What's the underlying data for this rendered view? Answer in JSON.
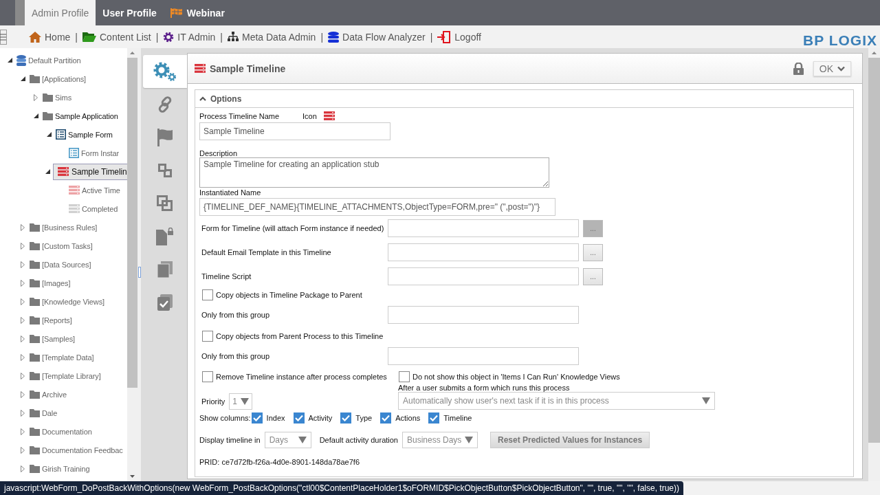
{
  "top_tabs": [
    {
      "label": "Admin Profile",
      "selected": true,
      "kind": "plain"
    },
    {
      "label": "User Profile",
      "selected": false,
      "kind": "plain"
    },
    {
      "label": "Webinar",
      "selected": false,
      "kind": "flagged"
    }
  ],
  "nav_links": [
    {
      "label": "Home",
      "kind": "home"
    },
    {
      "label": "Content List",
      "kind": "folder"
    },
    {
      "label": "IT Admin",
      "kind": "gear"
    },
    {
      "label": "Meta Data Admin",
      "kind": "hierarchy"
    },
    {
      "label": "Data Flow Analyzer",
      "kind": "database"
    },
    {
      "label": "Logoff",
      "kind": "logoff"
    }
  ],
  "nav_separator": "|",
  "logo": "BP LOGIX",
  "tree": [
    {
      "label": "Default Partition",
      "kind": "database",
      "expanded": true,
      "selected": false,
      "active": false,
      "children": [
        {
          "label": "[Applications]",
          "kind": "folder",
          "expanded": true,
          "selected": false,
          "active": false,
          "children": [
            {
              "label": "Sims",
              "kind": "folder",
              "expanded": false,
              "selected": false,
              "active": false
            },
            {
              "label": "Sample Application",
              "kind": "folder",
              "expanded": true,
              "selected": false,
              "active": true,
              "children": [
                {
                  "label": "Sample Form",
                  "kind": "form",
                  "expanded": true,
                  "selected": false,
                  "active": true,
                  "children": [
                    {
                      "label": "Form Instar",
                      "kind": "form-instance",
                      "selected": false,
                      "active": false
                    }
                  ]
                },
                {
                  "label": "Sample Timelin",
                  "kind": "timeline",
                  "expanded": true,
                  "selected": true,
                  "active": true,
                  "children": [
                    {
                      "label": "Active Time",
                      "kind": "timeline-active",
                      "selected": false,
                      "active": false
                    },
                    {
                      "label": "Completed",
                      "kind": "timeline-completed",
                      "selected": false,
                      "active": false
                    }
                  ]
                }
              ]
            }
          ]
        },
        {
          "label": "[Business Rules]",
          "kind": "folder",
          "expanded": false,
          "selected": false,
          "active": false
        },
        {
          "label": "[Custom Tasks]",
          "kind": "folder",
          "expanded": false,
          "selected": false,
          "active": false
        },
        {
          "label": "[Data Sources]",
          "kind": "folder",
          "expanded": false,
          "selected": false,
          "active": false
        },
        {
          "label": "[Images]",
          "kind": "folder",
          "expanded": false,
          "selected": false,
          "active": false
        },
        {
          "label": "[Knowledge Views]",
          "kind": "folder",
          "expanded": false,
          "selected": false,
          "active": false
        },
        {
          "label": "[Reports]",
          "kind": "folder",
          "expanded": false,
          "selected": false,
          "active": false
        },
        {
          "label": "[Samples]",
          "kind": "folder",
          "expanded": false,
          "selected": false,
          "active": false
        },
        {
          "label": "[Template Data]",
          "kind": "folder",
          "expanded": false,
          "selected": false,
          "active": false
        },
        {
          "label": "[Template Library]",
          "kind": "folder",
          "expanded": false,
          "selected": false,
          "active": false
        },
        {
          "label": "Archive",
          "kind": "folder",
          "expanded": false,
          "selected": false,
          "active": false
        },
        {
          "label": "Dale",
          "kind": "folder",
          "expanded": false,
          "selected": false,
          "active": false
        },
        {
          "label": "Documentation",
          "kind": "folder",
          "expanded": false,
          "selected": false,
          "active": false
        },
        {
          "label": "Documentation Feedbac",
          "kind": "folder",
          "expanded": false,
          "selected": false,
          "active": false
        },
        {
          "label": "Girish Training",
          "kind": "folder",
          "expanded": false,
          "selected": false,
          "active": false
        }
      ]
    }
  ],
  "side_tabs": [
    {
      "kind": "gears",
      "selected": true
    },
    {
      "kind": "link",
      "selected": false
    },
    {
      "kind": "flag",
      "selected": false
    },
    {
      "kind": "squares",
      "selected": false
    },
    {
      "kind": "overlap",
      "selected": false
    },
    {
      "kind": "doc-lock",
      "selected": false
    },
    {
      "kind": "copies",
      "selected": false
    },
    {
      "kind": "doc-check",
      "selected": false
    }
  ],
  "panel": {
    "title": "Sample Timeline",
    "ok_button": "OK"
  },
  "options": {
    "title": "Options",
    "expanded": true,
    "name_label": "Process Timeline Name",
    "icon_label": "Icon",
    "name_value": "Sample Timeline",
    "description_label": "Description",
    "description_value": "Sample Timeline for creating an application stub",
    "instantiated_label": "Instantiated Name",
    "instantiated_value": "{TIMELINE_DEF_NAME}{TIMELINE_ATTACHMENTS,ObjectType=FORM,pre=\" (\",post=\")\"}",
    "pickers": [
      {
        "label": "Form for Timeline (will attach Form instance if needed)",
        "button": "...",
        "pressed": true
      },
      {
        "label": "Default Email Template in this Timeline",
        "button": "...",
        "pressed": false
      },
      {
        "label": "Timeline Script",
        "button": "...",
        "pressed": false
      }
    ],
    "copy_options": [
      {
        "label": "Copy objects in Timeline Package to Parent",
        "checked": false,
        "group_label": "Only from this group"
      },
      {
        "label": "Copy objects from Parent Process to this Timeline",
        "checked": false,
        "group_label": "Only from this group"
      }
    ],
    "remove_option": {
      "label": "Remove Timeline instance after process completes",
      "checked": false
    },
    "hide_option": {
      "label": "Do not show this object in 'Items I Can Run' Knowledge Views",
      "checked": false
    },
    "priority": {
      "label": "Priority",
      "value": "1"
    },
    "after_submit": {
      "label": "After a user submits a form which runs this process",
      "value": "Automatically show user's next task if it is in this process"
    },
    "show_columns": {
      "label": "Show columns:",
      "items": [
        {
          "label": "Index",
          "checked": true
        },
        {
          "label": "Activity",
          "checked": true
        },
        {
          "label": "Type",
          "checked": true
        },
        {
          "label": "Actions",
          "checked": true
        },
        {
          "label": "Timeline",
          "checked": true
        }
      ]
    },
    "display_timeline": {
      "label": "Display timeline in",
      "value": "Days"
    },
    "default_duration": {
      "label": "Default activity duration",
      "value": "Business Days"
    },
    "reset_button": "Reset Predicted Values for Instances",
    "prid": "PRID: ce7d72fb-f26a-4d0e-8901-148da78ae7f6"
  },
  "status_bar": "javascript:WebForm_DoPostBackWithOptions(new WebForm_PostBackOptions(\"ctl00$ContentPlaceHolder1$oFORMID$PickObjectButton$PickObjectButton\", \"\", true, \"\", \"\", false, true))"
}
